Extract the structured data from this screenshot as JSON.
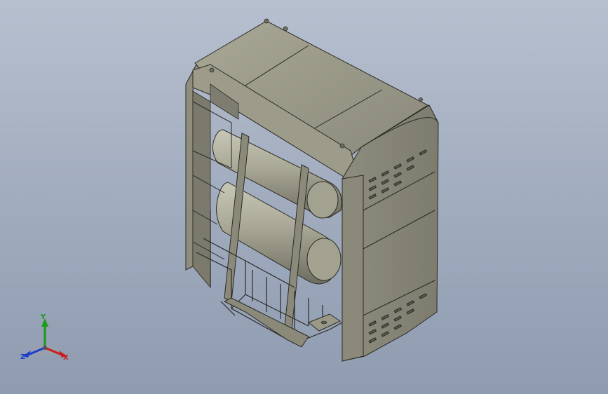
{
  "viewport": {
    "background_top": "#b7c0cf",
    "background_bottom": "#8f9bb0"
  },
  "model": {
    "body_color": "#8e8d7e",
    "body_dark": "#6f6e61",
    "body_light": "#b9b8a7",
    "edge_color": "#2a2a24"
  },
  "triad": {
    "x_label": "X",
    "y_label": "Y",
    "z_label": "Z",
    "x_color": "#c81e1e",
    "y_color": "#1a9a1a",
    "z_color": "#1e3ec8"
  }
}
